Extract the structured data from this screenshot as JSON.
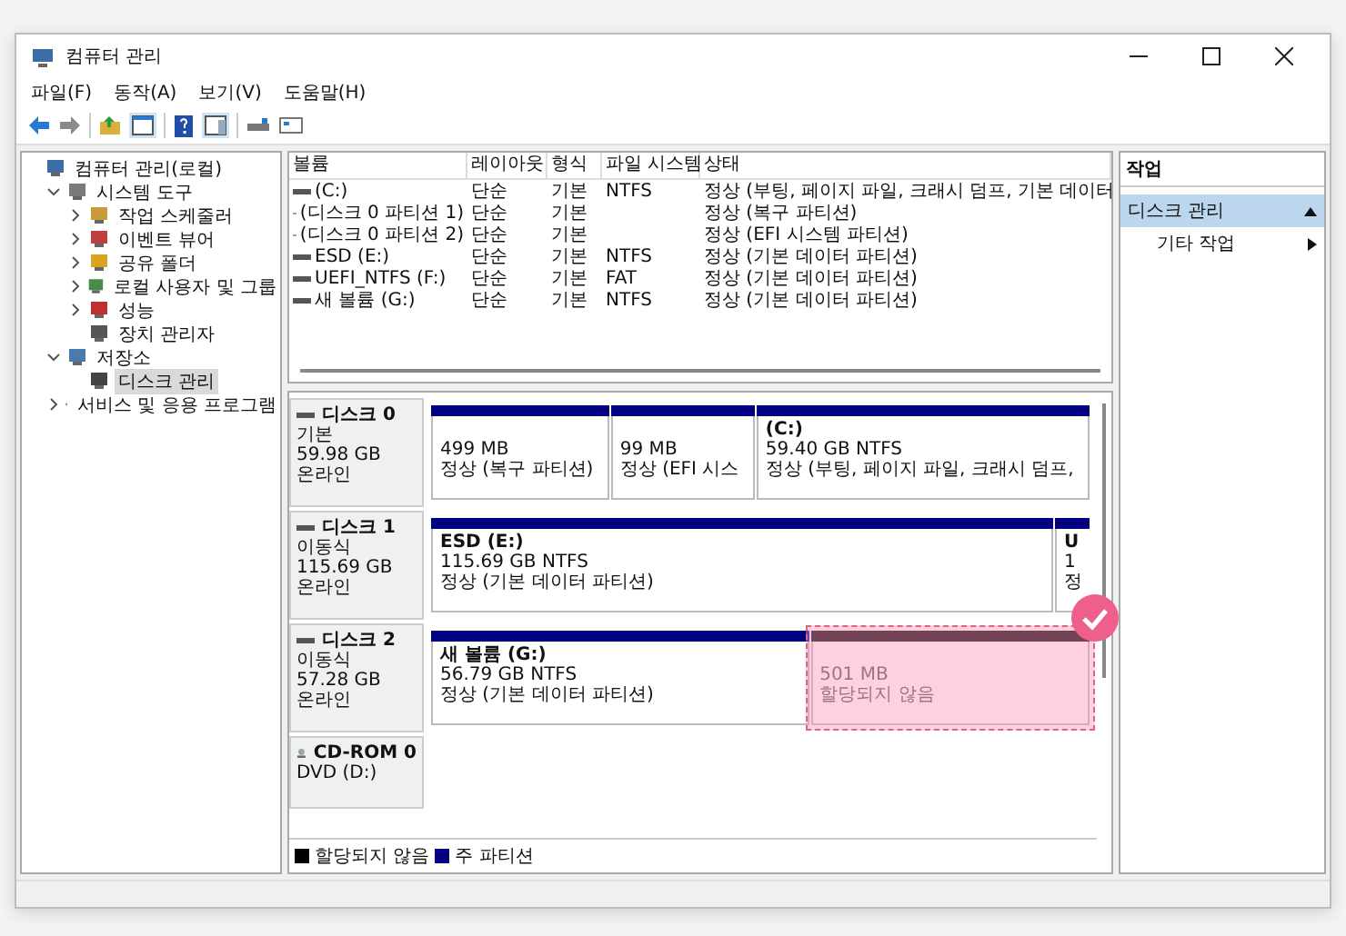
{
  "window": {
    "title": "컴퓨터 관리"
  },
  "menu": [
    "파일(F)",
    "동작(A)",
    "보기(V)",
    "도움말(H)"
  ],
  "tree": [
    {
      "label": "컴퓨터 관리(로컬)",
      "selected": false,
      "children": [
        {
          "label": "시스템 도구",
          "expanded": true,
          "selected": false,
          "children": [
            {
              "label": "작업 스케줄러",
              "expanded": false,
              "selected": false
            },
            {
              "label": "이벤트 뷰어",
              "expanded": false,
              "selected": false
            },
            {
              "label": "공유 폴더",
              "expanded": false,
              "selected": false
            },
            {
              "label": "로컬 사용자 및 그룹",
              "expanded": false,
              "selected": false
            },
            {
              "label": "성능",
              "expanded": false,
              "selected": false
            },
            {
              "label": "장치 관리자",
              "selected": false
            }
          ]
        },
        {
          "label": "저장소",
          "expanded": true,
          "selected": false,
          "children": [
            {
              "label": "디스크 관리",
              "selected": true
            }
          ]
        },
        {
          "label": "서비스 및 응용 프로그램",
          "expanded": false,
          "selected": false
        }
      ]
    }
  ],
  "volume_table": {
    "columns": [
      "볼륨",
      "레이아웃",
      "형식",
      "파일 시스템",
      "상태"
    ],
    "rows": [
      [
        "(C:)",
        "단순",
        "기본",
        "NTFS",
        "정상 (부팅, 페이지 파일, 크래시 덤프, 기본 데이터"
      ],
      [
        "(디스크 0 파티션 1)",
        "단순",
        "기본",
        "",
        "정상 (복구 파티션)"
      ],
      [
        "(디스크 0 파티션 2)",
        "단순",
        "기본",
        "",
        "정상 (EFI 시스템 파티션)"
      ],
      [
        "ESD (E:)",
        "단순",
        "기본",
        "NTFS",
        "정상 (기본 데이터 파티션)"
      ],
      [
        "UEFI_NTFS (F:)",
        "단순",
        "기본",
        "FAT",
        "정상 (기본 데이터 파티션)"
      ],
      [
        "새 볼륨 (G:)",
        "단순",
        "기본",
        "NTFS",
        "정상 (기본 데이터 파티션)"
      ]
    ]
  },
  "disks": [
    {
      "kind": "disk",
      "name": "디스크 0",
      "type": "기본",
      "size": "59.98 GB",
      "status": "온라인",
      "partitions": [
        {
          "kind": "primary",
          "size": "499 MB",
          "status": "정상 (복구 파티션)"
        },
        {
          "kind": "primary",
          "size": "99 MB",
          "status": "정상 (EFI 시스"
        },
        {
          "kind": "primary",
          "label": "(C:)",
          "size": "59.40 GB NTFS",
          "status": "정상 (부팅, 페이지 파일, 크래시 덤프,"
        }
      ]
    },
    {
      "kind": "disk",
      "name": "디스크 1",
      "type": "이동식",
      "size": "115.69 GB",
      "status": "온라인",
      "partitions": [
        {
          "kind": "primary",
          "label": "ESD  (E:)",
          "size": "115.69 GB NTFS",
          "status": "정상 (기본 데이터 파티션)"
        },
        {
          "kind": "primary",
          "label": "U",
          "size": "1",
          "status": "정",
          "cut": true
        }
      ]
    },
    {
      "kind": "disk",
      "name": "디스크 2",
      "type": "이동식",
      "size": "57.28 GB",
      "status": "온라인",
      "partitions": [
        {
          "kind": "primary",
          "label": "새 볼륨  (G:)",
          "size": "56.79 GB NTFS",
          "status": "정상 (기본 데이터 파티션)"
        },
        {
          "kind": "unallocated",
          "size": "501 MB",
          "status": "할당되지 않음",
          "highlighted": true
        }
      ]
    },
    {
      "kind": "cdrom",
      "name": "CD-ROM 0",
      "type": "DVD (D:)"
    }
  ],
  "legend": [
    {
      "label": "할당되지 않음",
      "color": "#000000"
    },
    {
      "label": "주 파티션",
      "color": "#000080"
    }
  ],
  "actions": {
    "title": "작업",
    "items": [
      {
        "kind": "section",
        "label": "디스크 관리"
      },
      {
        "kind": "item",
        "label": "기타 작업"
      }
    ]
  }
}
